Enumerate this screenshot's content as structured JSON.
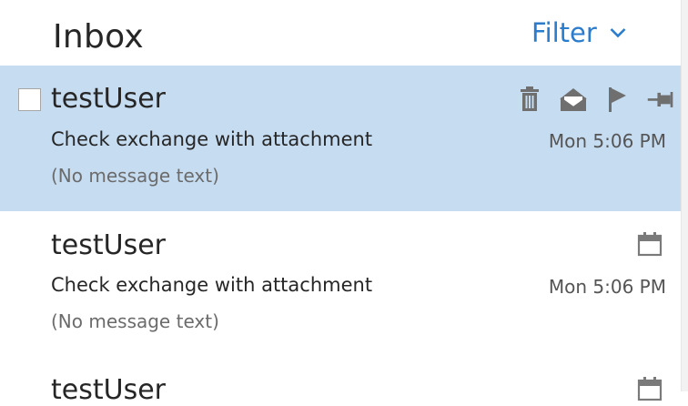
{
  "header": {
    "title": "Inbox",
    "filter_label": "Filter"
  },
  "messages": [
    {
      "sender": "testUser",
      "subject": "Check exchange with attachment",
      "preview": "(No message text)",
      "time": "Mon 5:06 PM",
      "selected": true
    },
    {
      "sender": "testUser",
      "subject": "Check exchange with attachment",
      "preview": "(No message text)",
      "time": "Mon 5:06 PM",
      "selected": false
    },
    {
      "sender": "testUser"
    }
  ],
  "colors": {
    "accent": "#2b7ccd",
    "selected_row": "#c6dcf1",
    "icon": "#6f6f6f"
  },
  "icons": {
    "row_actions": [
      "trash-icon",
      "mark-read-icon",
      "flag-icon",
      "pin-icon"
    ],
    "calendar": "calendar-icon",
    "filter": "chevron-down-icon"
  }
}
